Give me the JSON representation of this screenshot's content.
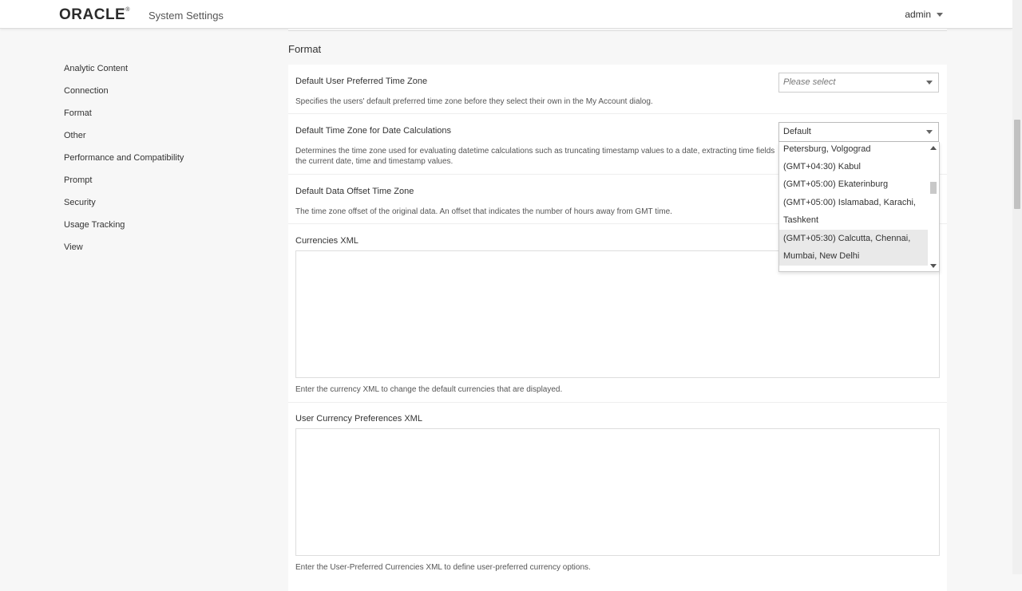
{
  "header": {
    "logo_text": "ORACLE",
    "logo_mark": "®",
    "app_title": "System Settings",
    "user": "admin"
  },
  "sidebar": {
    "items": [
      {
        "label": "Analytic Content"
      },
      {
        "label": "Connection"
      },
      {
        "label": "Format"
      },
      {
        "label": "Other"
      },
      {
        "label": "Performance and Compatibility"
      },
      {
        "label": "Prompt"
      },
      {
        "label": "Security"
      },
      {
        "label": "Usage Tracking"
      },
      {
        "label": "View"
      }
    ]
  },
  "main": {
    "section_title": "Format",
    "settings": {
      "preferred_tz": {
        "label": "Default User Preferred Time Zone",
        "placeholder": "Please select",
        "description": "Specifies the users' default preferred time zone before they select their own in the My Account dialog."
      },
      "date_calc_tz": {
        "label": "Default Time Zone for Date Calculations",
        "value": "Default",
        "description_line1": "Determines the time zone used for evaluating datetime calculations such as truncating timestamp values to a date, extracting time fields",
        "description_line2": "the current date, time and timestamp values."
      },
      "offset_tz": {
        "label": "Default Data Offset Time Zone",
        "description": "The time zone offset of the original data. An offset that indicates the number of hours away from GMT time."
      },
      "currencies_xml": {
        "label": "Currencies XML",
        "description": "Enter the currency XML to change the default currencies that are displayed."
      },
      "user_currency_xml": {
        "label": "User Currency Preferences XML",
        "description": "Enter the User-Preferred Currencies XML to define user-preferred currency options."
      }
    },
    "dropdown_options": [
      {
        "text": "Petersburg, Volgograd",
        "selected": false
      },
      {
        "text": "(GMT+04:30) Kabul",
        "selected": false
      },
      {
        "text": "(GMT+05:00) Ekaterinburg",
        "selected": false
      },
      {
        "text": "(GMT+05:00) Islamabad, Karachi,",
        "selected": false
      },
      {
        "text": "Tashkent",
        "selected": false
      },
      {
        "text": "(GMT+05:30) Calcutta, Chennai,",
        "selected": true
      },
      {
        "text": "Mumbai, New Delhi",
        "selected": true
      }
    ]
  }
}
